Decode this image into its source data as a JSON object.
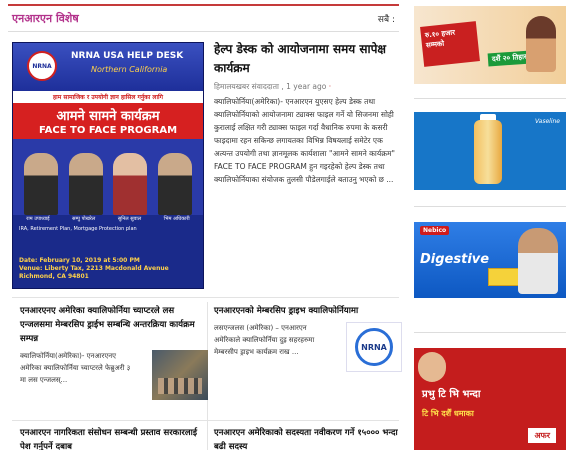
{
  "section": {
    "title": "एनआरएन विशेष",
    "all_link": "सबै :"
  },
  "feature": {
    "title": "हेल्प डेस्क को आयोजनामा समय सापेक्ष कार्यक्रम",
    "author": "हिमालयखबर संवाददाता",
    "time": "1 year ago",
    "excerpt": "क्यालिफोर्निया(अमेरिका)- एनआरएन युएसए हेल्प डेस्क तथा क्यालिफोर्नियाको आयोजनामा ट्याक्स फाइल गर्ने यो सिजनमा सोही कुरालाई लक्षित गरी ट्याक्स फाइल गर्दा वैधानिक रुपमा के कसरी फाइदामा रहन सकिन्छ लगायतका विभिन्न विषयलाई समेटेर एक अत्यन्त उपयोगी तथा ज्ञानमूलक कार्यशाला \"आमने सामने कार्यक्रम\" FACE TO FACE PROGRAM हुन गइरहेको हेल्प डेस्क तथा क्यालिफोर्नियाका संयोजक तुलसी पौडेलगाईले बताउनु भएको छ ...",
    "poster": {
      "logo": "NRNA",
      "heading": "NRNA USA HELP DESK",
      "subheading": "Northern California",
      "band": "हाम सामाजिक र उपयोगी ज्ञान हासिल गर्नुका लागि",
      "red_title": "आमने सामने कार्यक्रम",
      "program": "FACE TO FACE PROGRAM",
      "names": [
        "राम उपाध्याई",
        "सम्पु पोखरेल",
        "सुनिल सुवाल",
        "भिम अधिकारी"
      ],
      "info": "IRA, Retirement Plan, Mortgage Protection plan",
      "date": "Date: February 10, 2019  at 5:00 PM",
      "venue": "Venue: Liberty Tax, 2213 Macdonald Avenue Richmond, CA 94801"
    }
  },
  "posts": [
    {
      "title": "एनआरएनए अमेरिका क्यालिफोर्निया च्याप्टरले लस एन्जलसमा मेम्बरसिप ड्राईभ सम्बन्धि अन्तरक्रिया कार्यक्रम सम्पन्न",
      "excerpt": "क्यालिफोर्निया(अमेरिका)- एनआरएनए अमेरिका क्यालिफोर्निया च्याप्टरले फेब्रुअरी ३ मा लस एन्जलस्...",
      "thumb": "crowd"
    },
    {
      "title": "एनआरएनको मेम्बरसिप ड्राइभ क्यालिफोर्नियामा",
      "excerpt": "लसएन्जलस (अमेरिका) – एनआरएन अमेरिकाले क्यालिफोर्निया दुइ सहरहरुमा मेम्बरसीप ड्राइभ कार्यक्रम राख ...",
      "thumb": "nrna",
      "thumb_label": "NRNA"
    },
    {
      "title": "एनआरएन नागरिकता संसोधन सम्बन्धी प्रस्ताव सरकारलाई पेश गर्नुपर्ने दबाब"
    },
    {
      "title": "एनआरएन अमेरिकाको सदस्यता नवीकरण गर्ने १५००० भन्दा बढी सदस्य"
    }
  ],
  "ads": {
    "ad1": {
      "badge": "रु.१० हजार सम्मको",
      "tag": "दशैं २० तिहार"
    },
    "ad2": {
      "brand": "Vaseline"
    },
    "ad3": {
      "brand": "Nebico",
      "title": "Digestive"
    },
    "ad4": {
      "line1": "प्रभु टि भि भन्दा",
      "line2": "टि भि दर्शैं धमाका",
      "offer": "अफर"
    }
  }
}
